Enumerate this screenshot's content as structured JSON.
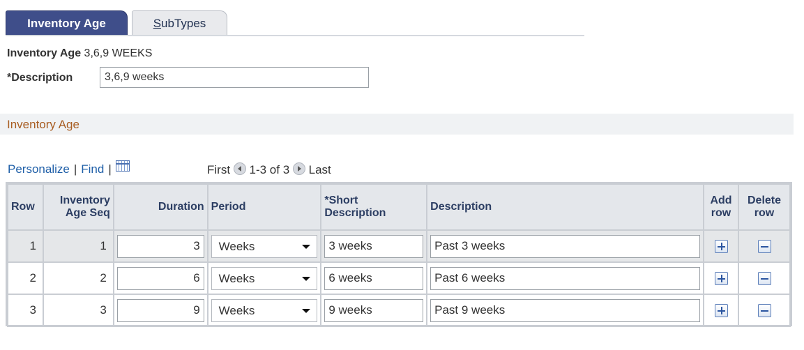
{
  "tabs": [
    {
      "label": "Inventory Age",
      "active": true
    },
    {
      "label_underline": "S",
      "label_rest": "ubTypes",
      "active": false
    }
  ],
  "header": {
    "inventory_age_label": "Inventory Age",
    "inventory_age_value": "3,6,9 WEEKS",
    "description_label": "*Description",
    "description_value": "3,6,9 weeks"
  },
  "section": {
    "title": "Inventory Age"
  },
  "toolbar": {
    "personalize": "Personalize",
    "separator": "|",
    "find": "Find",
    "first": "First",
    "range": "1-3 of 3",
    "last": "Last"
  },
  "grid": {
    "columns": {
      "row": "Row",
      "seq_1": "Inventory",
      "seq_2": "Age Seq",
      "duration": "Duration",
      "period": "Period",
      "short_1": "*Short",
      "short_2": "Description",
      "description": "Description",
      "add_1": "Add",
      "add_2": "row",
      "delete_1": "Delete",
      "delete_2": "row"
    },
    "rows": [
      {
        "row": "1",
        "seq": "1",
        "duration": "3",
        "period": "Weeks",
        "short_description": "3 weeks",
        "description": "Past 3 weeks"
      },
      {
        "row": "2",
        "seq": "2",
        "duration": "6",
        "period": "Weeks",
        "short_description": "6 weeks",
        "description": "Past 6 weeks"
      },
      {
        "row": "3",
        "seq": "3",
        "duration": "9",
        "period": "Weeks",
        "short_description": "9 weeks",
        "description": "Past 9 weeks"
      }
    ]
  },
  "colors": {
    "active_tab": "#3f4e8a",
    "link": "#1f5fa8",
    "section_title": "#a85d22",
    "header_bg": "#e4e7eb"
  },
  "icons": {
    "prev": "circle-left-arrow-icon",
    "next": "circle-right-arrow-icon",
    "grid": "grid-view-icon",
    "add": "plus-icon",
    "delete": "minus-icon"
  }
}
